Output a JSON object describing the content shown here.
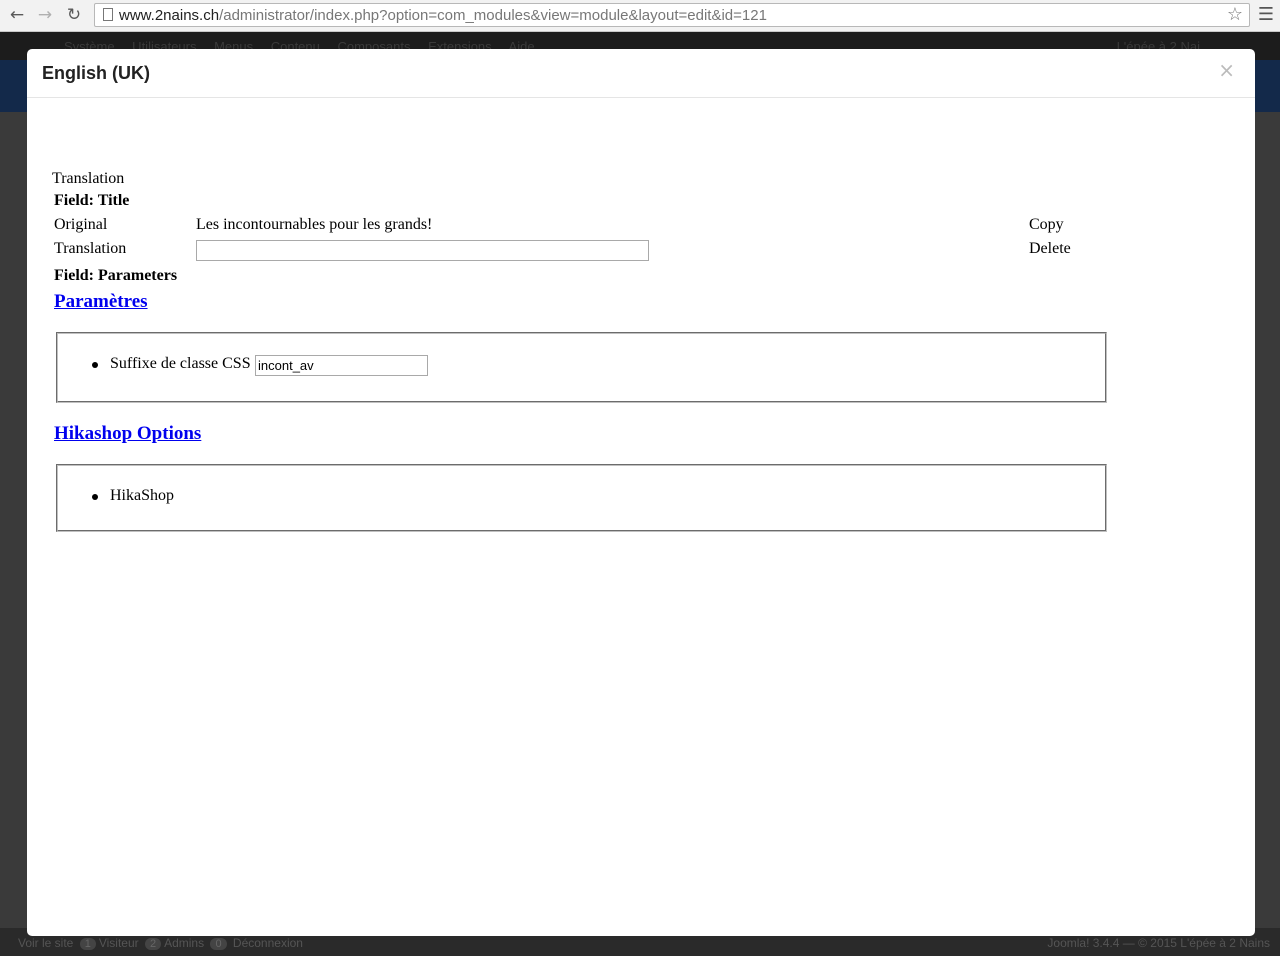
{
  "browser": {
    "back_icon": "back-arrow-icon",
    "forward_icon": "forward-arrow-icon",
    "reload_icon": "reload-icon",
    "url_host": "www.2nains.ch",
    "url_path": "/administrator/index.php?option=com_modules&view=module&layout=edit&id=121"
  },
  "admin_bg": {
    "menu": "Système Utilisateurs Menus Contenu Composants Extensions Aide",
    "user": "L'épée à 2 Nai",
    "footer_left": {
      "view_site": "Voir le site",
      "visitors_count": "1",
      "visitors_label": "Visiteur",
      "admins_count": "2",
      "admins_label": "Admins",
      "messages_count": "0",
      "logout": "Déconnexion"
    },
    "footer_right": "Joomla! 3.4.4 — © 2015 L'épée à 2 Nains"
  },
  "modal": {
    "title": "English (UK)",
    "close_glyph": "×",
    "translation_heading": "Translation",
    "field_title_label": "Field: Title",
    "original_label": "Original",
    "original_value": "Les incontournables pour les grands!",
    "translation_label": "Translation",
    "translation_value": "",
    "copy_label": "Copy",
    "delete_label": "Delete",
    "field_params_label": "Field: Parameters",
    "sections": [
      {
        "title": "Paramètres",
        "item_label": "Suffixe de classe CSS",
        "item_value": "incont_av"
      },
      {
        "title": "Hikashop Options",
        "item_label": "HikaShop"
      }
    ]
  }
}
